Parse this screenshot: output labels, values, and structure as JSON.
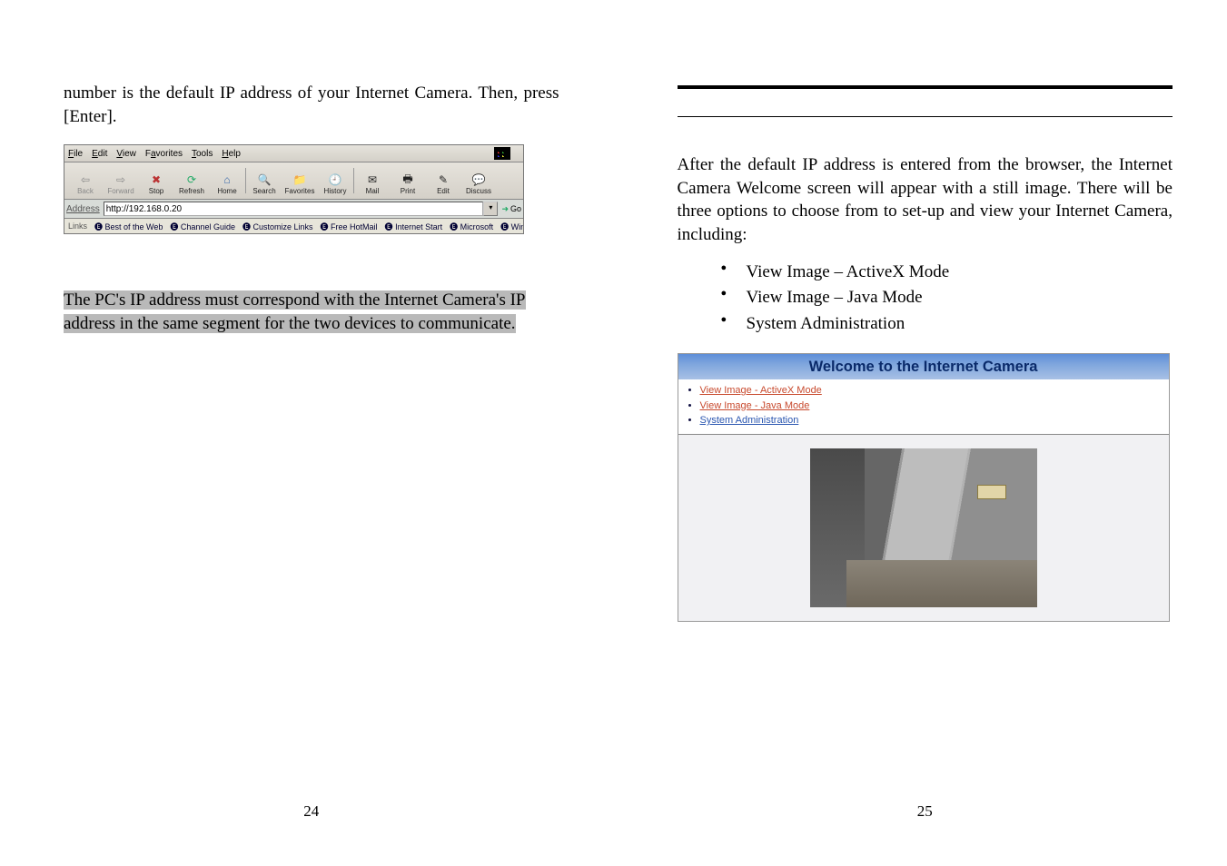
{
  "left": {
    "intro": "number is the default IP address of your Internet Camera.  Then, press [Enter].",
    "menus": {
      "file": "File",
      "edit": "Edit",
      "view": "View",
      "fav": "Favorites",
      "tools": "Tools",
      "help": "Help"
    },
    "toolbar": {
      "back": "Back",
      "forward": "Forward",
      "stop": "Stop",
      "refresh": "Refresh",
      "home": "Home",
      "search": "Search",
      "favorites": "Favorites",
      "history": "History",
      "mail": "Mail",
      "print": "Print",
      "edit": "Edit",
      "discuss": "Discuss"
    },
    "address_label": "Address",
    "address_value": "http://192.168.0.20",
    "go_label": "Go",
    "links_label": "Links",
    "links": [
      "Best of the Web",
      "Channel Guide",
      "Customize Links",
      "Free HotMail",
      "Internet Start",
      "Microsoft",
      "Windows Update"
    ],
    "note": "The PC's IP address must correspond with the Internet Camera's IP address in the same segment for the two devices to communicate.",
    "pagenum": "24"
  },
  "right": {
    "para": "After the default IP address is entered from the browser, the Internet Camera Welcome screen will appear with a still image. There will be three options to choose from to set-up and view your Internet Camera, including:",
    "opts": [
      "View Image – ActiveX Mode",
      "View Image – Java Mode",
      "System Administration"
    ],
    "welcome_title": "Welcome to the Internet Camera",
    "welcome_links": [
      "View Image - ActiveX Mode",
      "View Image - Java Mode",
      "System Administration"
    ],
    "pagenum": "25"
  }
}
